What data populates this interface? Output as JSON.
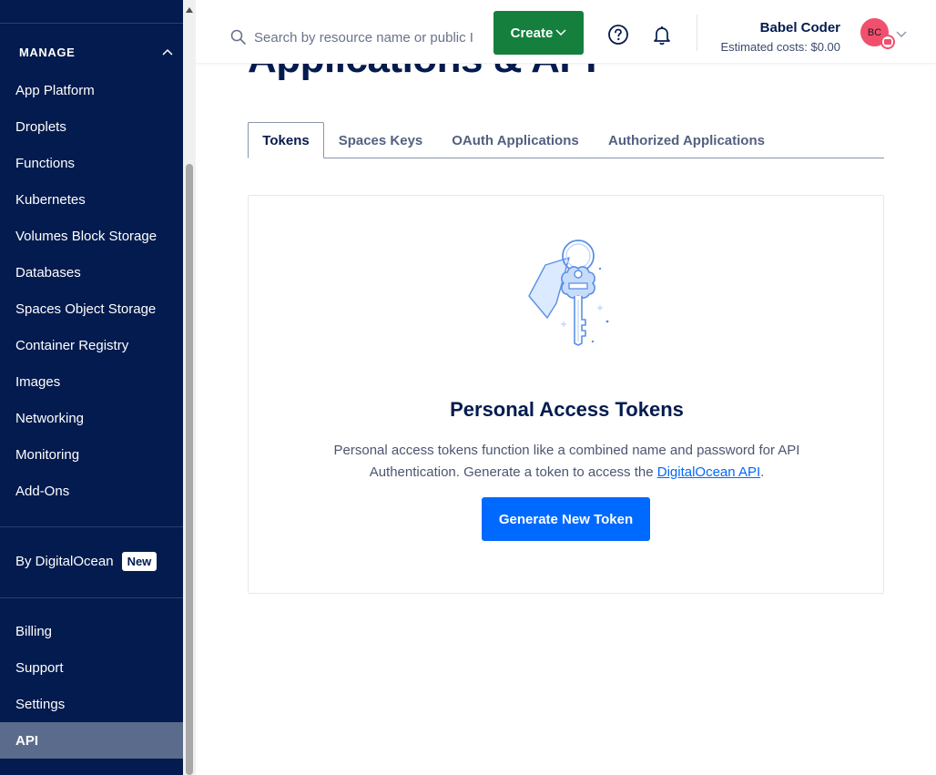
{
  "sidebar": {
    "section_title": "MANAGE",
    "items": [
      {
        "label": "App Platform"
      },
      {
        "label": "Droplets"
      },
      {
        "label": "Functions"
      },
      {
        "label": "Kubernetes"
      },
      {
        "label": "Volumes Block Storage"
      },
      {
        "label": "Databases"
      },
      {
        "label": "Spaces Object Storage"
      },
      {
        "label": "Container Registry"
      },
      {
        "label": "Images"
      },
      {
        "label": "Networking"
      },
      {
        "label": "Monitoring"
      },
      {
        "label": "Add-Ons"
      }
    ],
    "by_do": {
      "label": "By DigitalOcean",
      "badge": "New"
    },
    "bottom_items": [
      {
        "label": "Billing"
      },
      {
        "label": "Support"
      },
      {
        "label": "Settings"
      },
      {
        "label": "API",
        "active": true
      }
    ]
  },
  "topbar": {
    "search_placeholder": "Search by resource name or public IP",
    "create_label": "Create",
    "user_name": "Babel Coder",
    "estimated_costs": "Estimated costs: $0.00",
    "avatar_initials": "BC"
  },
  "page": {
    "title": "Applications & API"
  },
  "tabs": [
    {
      "label": "Tokens",
      "active": true
    },
    {
      "label": "Spaces Keys"
    },
    {
      "label": "OAuth Applications"
    },
    {
      "label": "Authorized Applications"
    }
  ],
  "card": {
    "title": "Personal Access Tokens",
    "desc_line1": "Personal access tokens function like a combined name and password for API",
    "desc_line2_prefix": "Authentication. Generate a token to access the ",
    "desc_link": "DigitalOcean API",
    "desc_suffix": ".",
    "button_label": "Generate New Token"
  },
  "colors": {
    "sidebar_bg": "#031b4e",
    "create_green": "#15803d",
    "primary_blue": "#0069ff",
    "avatar_pink": "#f0506e"
  }
}
